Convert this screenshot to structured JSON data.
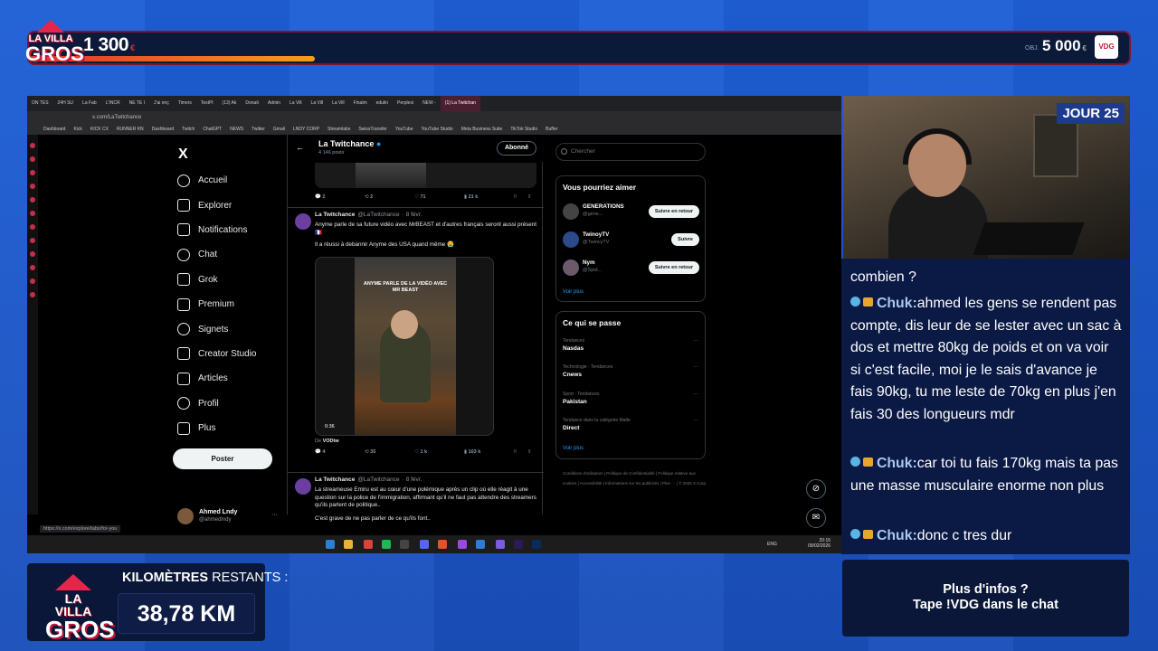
{
  "overlay": {
    "logo_line1": "LA VILLA",
    "logo_line2": "GROS",
    "counter_value": "1 300",
    "counter_unit": "€",
    "goal_label": "OBJ.",
    "goal_value": "5 000",
    "goal_unit": "€",
    "goal_progress": 0.26,
    "day_badge": "JOUR 25",
    "km_label_bold": "KILOMÈTRES",
    "km_label_rest": " RESTANTS :",
    "km_value": "38,78 KM",
    "info_line1": "Plus d'infos ?",
    "info_line2": "Tape !VDG dans le chat"
  },
  "browser": {
    "tabs": [
      "ON TES",
      "24H SU",
      "La Fab",
      "L'INCR",
      "NE TE I",
      "J'ai enç",
      "Timers",
      "TextPl",
      "(13) Ak",
      "Donati",
      "Admin",
      "La Vill",
      "La Vill",
      "La Vill",
      "Finalm",
      "edulin",
      "Perplexi",
      "NEW -",
      "(1) La Twitchan"
    ],
    "active_tab": "(1) La Twitchan",
    "url": "x.com/LaTwitchance",
    "bookmarks": [
      "Dashboard",
      "Kick",
      "KICK CX",
      "RUNNER KN",
      "Dashboard",
      "Twitch",
      "ChatGPT",
      "NEWS",
      "Twitter",
      "Gmail",
      "LNDY CORP",
      "Streamlabs",
      "SwissTransfer",
      "YouTube",
      "YouTube Studio",
      "Meta Business Suite",
      "TikTok Studio",
      "Buffer"
    ],
    "status_url": "https://x.com/explore/tabs/for-you"
  },
  "x_sidebar": {
    "logo": "X",
    "items": [
      {
        "label": "Accueil",
        "icon": "home-icon"
      },
      {
        "label": "Explorer",
        "icon": "search-icon"
      },
      {
        "label": "Notifications",
        "icon": "bell-icon"
      },
      {
        "label": "Chat",
        "icon": "chat-icon"
      },
      {
        "label": "Grok",
        "icon": "grok-icon"
      },
      {
        "label": "Premium",
        "icon": "x-icon"
      },
      {
        "label": "Signets",
        "icon": "bookmark-icon"
      },
      {
        "label": "Creator Studio",
        "icon": "chart-icon"
      },
      {
        "label": "Articles",
        "icon": "article-icon"
      },
      {
        "label": "Profil",
        "icon": "user-icon"
      },
      {
        "label": "Plus",
        "icon": "more-icon"
      }
    ],
    "post_button": "Poster",
    "account_name": "Ahmed Lndy",
    "account_handle": "@ahmedlndy"
  },
  "profile_header": {
    "name": "La Twitchance",
    "posts": "4 146 posts",
    "follow_label": "Abonné"
  },
  "first_actions": {
    "replies": "2",
    "reposts": "2",
    "likes": "71",
    "views": "21 k"
  },
  "tweets": [
    {
      "name": "La Twitchance",
      "handle": "@LaTwitchance",
      "date": "· 8 févr.",
      "text1": "Anyme parle de sa future vidéo avec MrBEAST et d'autres français seront aussi présent 🇫🇷",
      "text2": "Il a réussi à debannir Anyme des USA quand même 😭",
      "video_caption": "ANYME PARLE DE LA VIDÉO AVEC MR BEAST",
      "video_duration": "0:36",
      "from_label": "De",
      "from_account": "VODtw",
      "replies": "4",
      "reposts": "35",
      "likes": "1 k",
      "views": "103 k"
    },
    {
      "name": "La Twitchance",
      "handle": "@LaTwitchance",
      "date": "· 8 févr.",
      "text1": "La streameuse Emiru est au cœur d'une polémique après un clip où elle réagit à une question sur la police de l'immigration, affirmant qu'il ne faut pas attendre des streamers qu'ils parlent de politique..",
      "text2": "C'est grave de ne pas parler de ce qu'ils font.."
    }
  ],
  "right_column": {
    "search_placeholder": "Chercher",
    "suggest_title": "Vous pourriez aimer",
    "suggestions": [
      {
        "name": "GENERATIONS",
        "handle": "@gene...",
        "button": "Suivre en retour"
      },
      {
        "name": "TwinoyTV",
        "handle": "@TwincyTV",
        "button": "Suivre"
      },
      {
        "name": "Nym",
        "handle": "@Spid...",
        "button": "Suivre en retour"
      }
    ],
    "see_more": "Voir plus",
    "trends_title": "Ce qui se passe",
    "trends": [
      {
        "category": "Tendances",
        "name": "Nasdas"
      },
      {
        "category": "Technologie · Tendances",
        "name": "Cnews"
      },
      {
        "category": "Sport · Tendances",
        "name": "Pakistan"
      },
      {
        "category": "Tendance dans la catégorie Malte",
        "name": "Direct"
      }
    ],
    "trends_more": "Voir plus",
    "footer": "Conditions d'utilisation | Politique de Confidentialité | Politique relative aux cookies | Accessibilité | Informations sur les publicités | Plus ··· | © 2026 X Corp."
  },
  "taskbar": {
    "lang": "ENG",
    "time": "20:15",
    "date": "09/02/2026"
  },
  "chat": {
    "lines": [
      {
        "user": "",
        "text": "combien ?"
      },
      {
        "user": "Chuk",
        "text": "ahmed les gens se rendent pas compte, dis leur de se lester avec un sac à dos et mettre 80kg de poids et on va voir si c'est facile, moi je le sais d'avance je fais 90kg, tu me leste de 70kg en plus j'en fais 30 des longueurs mdr"
      },
      {
        "user": "Chuk",
        "text": "car toi tu fais 170kg mais ta pas une masse musculaire enorme non plus"
      },
      {
        "user": "Chuk",
        "text": "donc c tres dur"
      }
    ]
  },
  "colors": {
    "accent_red": "#c21838",
    "x_blue": "#1d9bf0",
    "panel_navy": "#0a1738"
  }
}
